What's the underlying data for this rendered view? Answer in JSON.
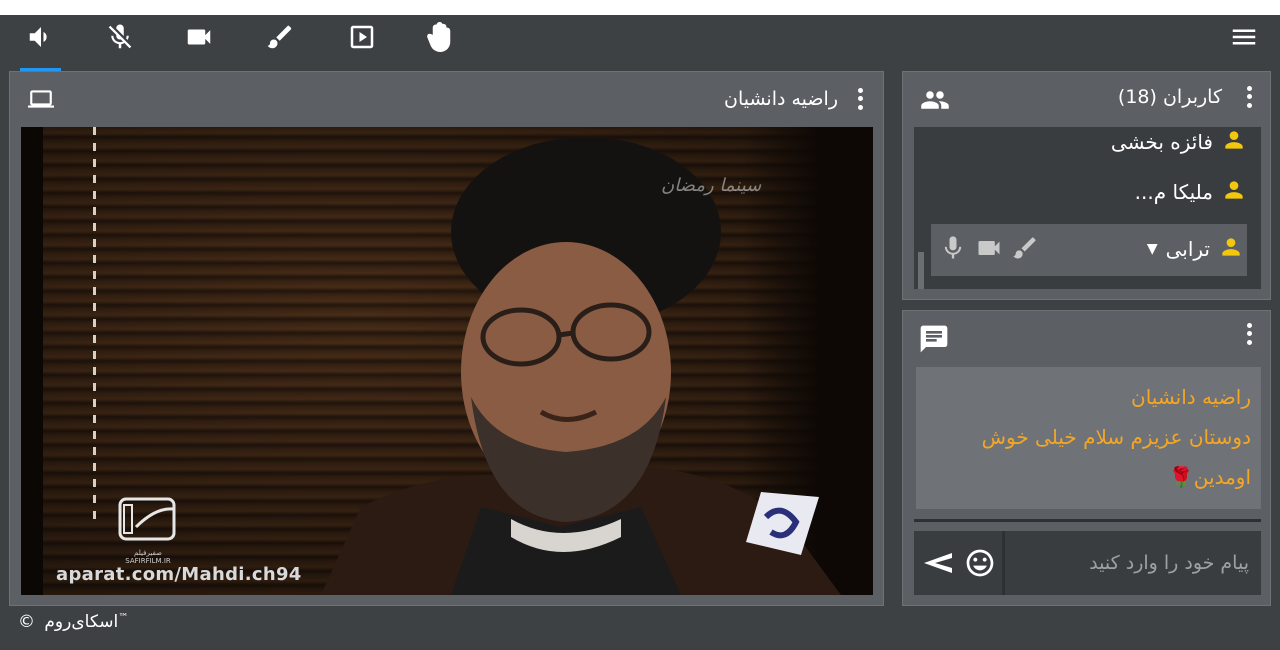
{
  "toolbar": {
    "items": [
      {
        "name": "speaker",
        "active": true
      },
      {
        "name": "mic-muted",
        "active": false
      },
      {
        "name": "video-camera",
        "active": false
      },
      {
        "name": "pencil",
        "active": false
      },
      {
        "name": "play-box",
        "active": false
      },
      {
        "name": "raise-hand",
        "active": false
      }
    ],
    "accent_color": "#2196f3"
  },
  "video_panel": {
    "presenter_name": "راضیه دانشیان",
    "video_watermark": "aparat.com/Mahdi.ch94",
    "channel_watermark": "سینما رمضان",
    "logo_text": "صفیرفیلم",
    "logo_subtext": "SAFIRFILM.IR",
    "icon": "desktop-icon"
  },
  "users_panel": {
    "title": "کاربران (18)",
    "icon": "group-icon",
    "users": [
      {
        "name": "فائزه بخشی"
      },
      {
        "name": "ملیکا م..."
      },
      {
        "name": "ترابی",
        "selected": true
      }
    ],
    "user_icon_color": "#f2c80f"
  },
  "chat_panel": {
    "icon": "chat-icon",
    "messages": [
      {
        "sender": "راضیه دانشیان",
        "text": "دوستان عزیزم سلام خیلی خوش اومدین🌹"
      }
    ],
    "message_color": "#f5a623",
    "input_placeholder": "پیام خود را وارد کنید"
  },
  "footer": {
    "brand": "اسکای‌روم",
    "copyright": "©",
    "trademark": "™"
  }
}
